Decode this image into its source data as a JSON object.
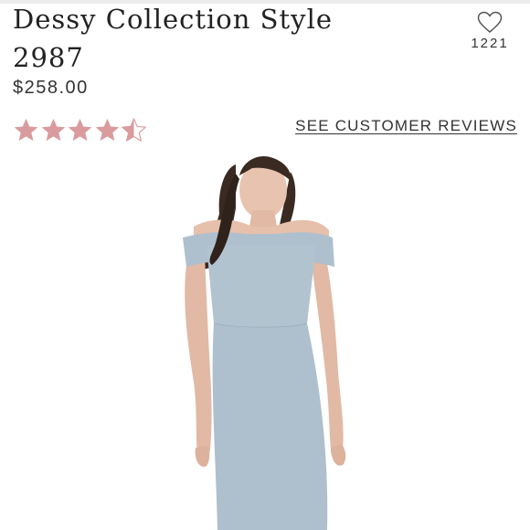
{
  "product": {
    "title": "Dessy Collection Style 2987",
    "price": "$258.00",
    "favorites_count": "1221",
    "rating": 4.5
  },
  "reviews": {
    "link_label": "SEE CUSTOMER REVIEWS"
  },
  "icons": {
    "favorite": "heart-outline-icon",
    "rating": "star-icon"
  },
  "colors": {
    "star_fill": "#d99b9d",
    "dress": "#aebfcd",
    "text": "#222222"
  }
}
